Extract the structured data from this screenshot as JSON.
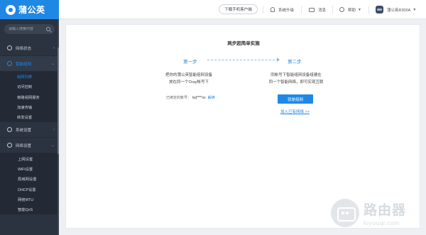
{
  "brand": {
    "name": "蒲公英"
  },
  "search": {
    "placeholder": "请输入搜索内容"
  },
  "sidebar": {
    "sections": [
      {
        "label": "网络状态"
      },
      {
        "label": "智能组网"
      },
      {
        "label": "系统设置"
      },
      {
        "label": "网络设置"
      }
    ],
    "group1_items": [
      {
        "label": "组网列表"
      },
      {
        "label": "访问控制"
      },
      {
        "label": "旁路组网服务"
      },
      {
        "label": "加速传输"
      },
      {
        "label": "转发设置"
      }
    ],
    "group2_items": [
      {
        "label": "上网设置"
      },
      {
        "label": "WiFi设置"
      },
      {
        "label": "局域网设置"
      },
      {
        "label": "DHCP设置"
      },
      {
        "label": "网络MTU"
      },
      {
        "label": "智能QoS"
      }
    ]
  },
  "header": {
    "download_label": "下载手机客户端",
    "upgrade_label": "系统升级",
    "message_label": "消息",
    "help_label": "帮助",
    "device_label": "蒲公英R300A"
  },
  "main": {
    "title": "两步超简单实施",
    "step1_label": "第一步",
    "step2_label": "第二步",
    "step1_line1": "把你的蒲公英智能组网设备",
    "step1_line2": "放在同一个Oray帐号下",
    "step2_line1": "同帐号下智能组网设备组建在",
    "step2_line2": "同一个智能网络，即可实现互联",
    "account_label": "已绑定的帐号：",
    "account_value": "lwj****xx",
    "unbind_label": "解绑",
    "join_button": "就是组网",
    "join_link": "加入已有网络 >>"
  },
  "watermark": {
    "cn": "路由器",
    "en": "luyouqi.com"
  },
  "colors": {
    "accent": "#1f88e5",
    "sidebar_bg": "#2b3340"
  }
}
